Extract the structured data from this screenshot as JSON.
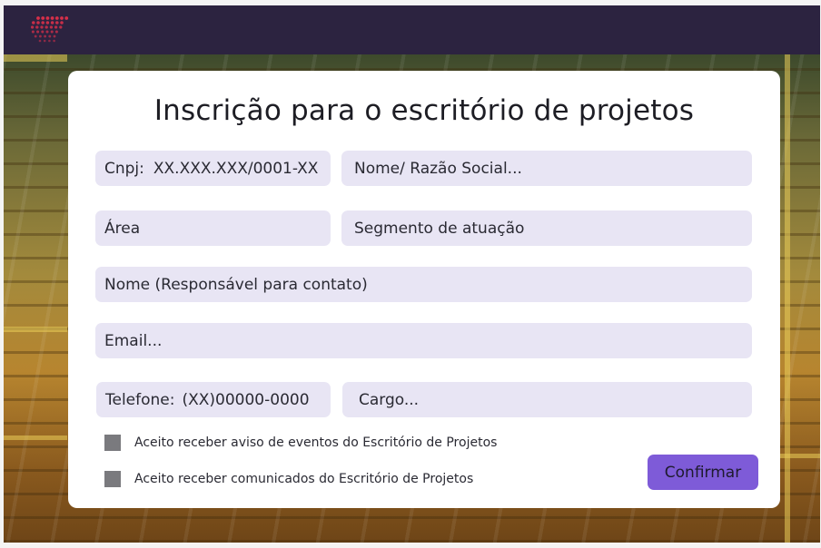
{
  "app": {
    "colors": {
      "topbar": "#2c2340",
      "field_bg": "#e8e5f4",
      "accent": "#7e5bd8",
      "logo": "#e0304a"
    },
    "logo_icon": "dotted-globe-logo"
  },
  "form": {
    "title": "Inscrição para o escritório de projetos",
    "fields": {
      "cnpj": {
        "label": "Cnpj:",
        "placeholder": "XX.XXX.XXX/0001-XX"
      },
      "nome_razao": {
        "placeholder": "Nome/ Razão Social..."
      },
      "area": {
        "placeholder": "Área"
      },
      "segmento": {
        "placeholder": "Segmento de atuação"
      },
      "nome_responsavel": {
        "placeholder": "Nome (Responsável para contato)"
      },
      "email": {
        "placeholder": "Email..."
      },
      "telefone": {
        "label": "Telefone:",
        "placeholder": "(XX)00000-0000"
      },
      "cargo": {
        "placeholder": "Cargo..."
      }
    },
    "checkboxes": {
      "eventos": {
        "label": "Aceito receber aviso de eventos do Escritório de Projetos",
        "checked": false
      },
      "comunicados": {
        "label": "Aceito receber comunicados do Escritório de Projetos",
        "checked": false
      }
    },
    "confirm_label": "Confirmar"
  }
}
